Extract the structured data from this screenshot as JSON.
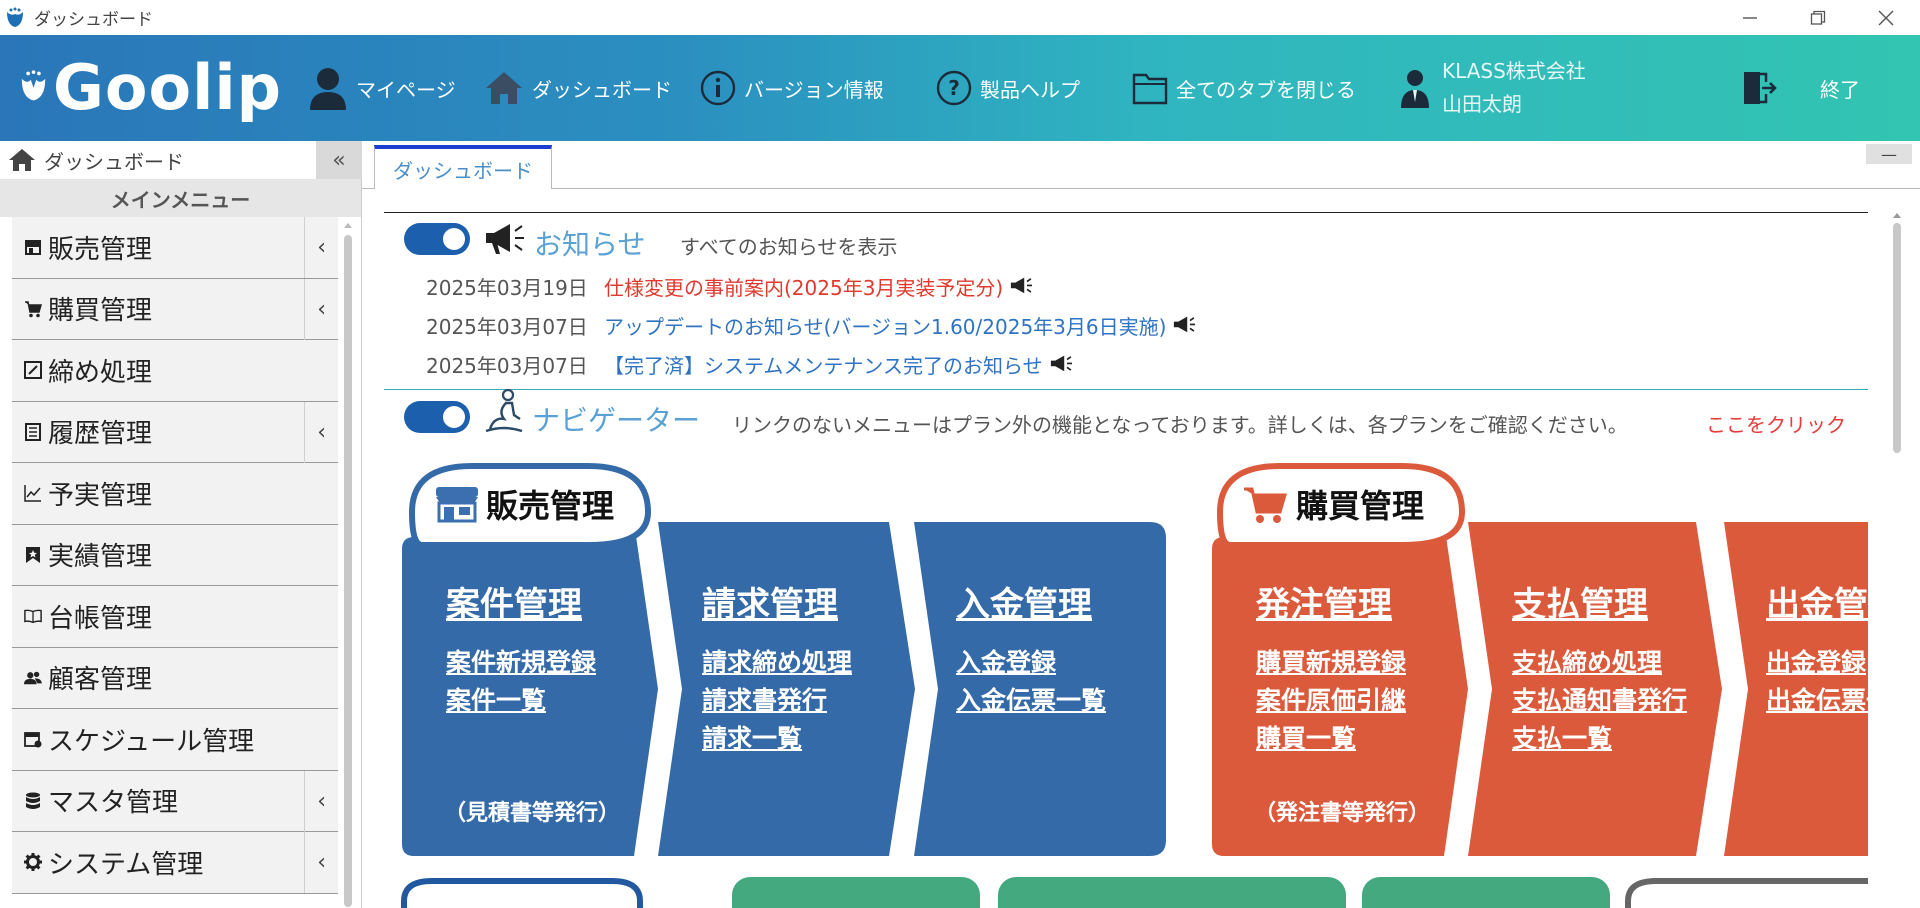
{
  "window": {
    "title": "ダッシュボード"
  },
  "header": {
    "logo": "Goolip",
    "nav": [
      {
        "label": "マイページ"
      },
      {
        "label": "ダッシュボード"
      },
      {
        "label": "バージョン情報"
      },
      {
        "label": "製品ヘルプ"
      },
      {
        "label": "全てのタブを閉じる"
      }
    ],
    "user": {
      "company": "KLASS株式会社",
      "name": "山田太朗"
    },
    "exit_label": "終了"
  },
  "sidebar": {
    "current": "ダッシュボード",
    "collapse": "«",
    "main_menu_title": "メインメニュー",
    "items": [
      {
        "label": "販売管理",
        "icon": "store-icon",
        "has_submenu": true
      },
      {
        "label": "購買管理",
        "icon": "cart-icon",
        "has_submenu": true
      },
      {
        "label": "締め処理",
        "icon": "edit-box-icon",
        "has_submenu": false
      },
      {
        "label": "履歴管理",
        "icon": "history-book-icon",
        "has_submenu": true
      },
      {
        "label": "予実管理",
        "icon": "chart-line-icon",
        "has_submenu": false
      },
      {
        "label": "実績管理",
        "icon": "bookmark-icon",
        "has_submenu": false
      },
      {
        "label": "台帳管理",
        "icon": "open-book-icon",
        "has_submenu": false
      },
      {
        "label": "顧客管理",
        "icon": "users-icon",
        "has_submenu": false
      },
      {
        "label": "スケジュール管理",
        "icon": "calendar-icon",
        "has_submenu": false
      },
      {
        "label": "マスタ管理",
        "icon": "database-icon",
        "has_submenu": true
      },
      {
        "label": "システム管理",
        "icon": "gear-icon",
        "has_submenu": true
      }
    ],
    "chevron": "‹"
  },
  "tabs": [
    {
      "label": "ダッシュボード",
      "active": true
    }
  ],
  "minimize_label": "—",
  "news": {
    "title": "お知らせ",
    "show_all": "すべてのお知らせを表示",
    "items": [
      {
        "date": "2025年03月19日",
        "text": "仕様変更の事前案内(2025年3月実装予定分)",
        "color": "#e03a2f"
      },
      {
        "date": "2025年03月07日",
        "text": "アップデートのお知らせ(バージョン1.60/2025年3月6日実施)",
        "color": "#2f73c3"
      },
      {
        "date": "2025年03月07日",
        "text": "【完了済】システムメンテナンス完了のお知らせ",
        "color": "#2f73c3"
      }
    ]
  },
  "navigator": {
    "title": "ナビゲーター",
    "note": "リンクのないメニューはプラン外の機能となっております。詳しくは、各プランをご確認ください。",
    "click_here": "ここをクリック"
  },
  "sales": {
    "label": "販売管理",
    "color": "#356aa8",
    "steps": [
      {
        "title": "案件管理",
        "links": [
          "案件新規登録",
          "案件一覧"
        ],
        "note": "（見積書等発行）"
      },
      {
        "title": "請求管理",
        "links": [
          "請求締め処理",
          "請求書発行",
          "請求一覧"
        ],
        "note": ""
      },
      {
        "title": "入金管理",
        "links": [
          "入金登録",
          "入金伝票一覧"
        ],
        "note": ""
      }
    ]
  },
  "purchase": {
    "label": "購買管理",
    "color": "#dc5a3c",
    "steps": [
      {
        "title": "発注管理",
        "links": [
          "購買新規登録",
          "案件原価引継",
          "購買一覧"
        ],
        "note": "（発注書等発行）"
      },
      {
        "title": "支払管理",
        "links": [
          "支払締め処理",
          "支払通知書発行",
          "支払一覧"
        ],
        "note": ""
      },
      {
        "title": "出金管理",
        "links": [
          "出金登録",
          "出金伝票一覧"
        ],
        "note": ""
      }
    ]
  }
}
